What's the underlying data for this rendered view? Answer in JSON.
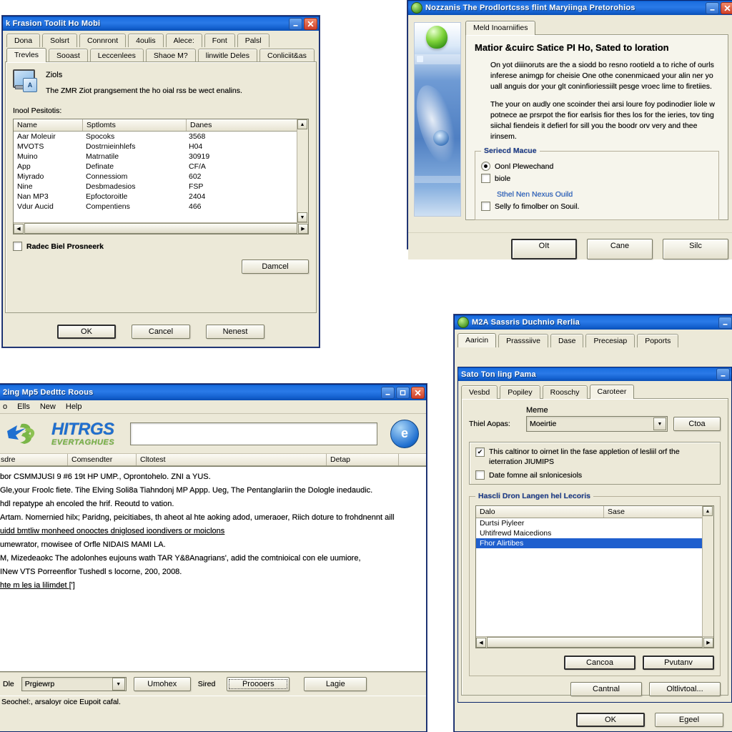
{
  "window1": {
    "title": "k Frasion Toolit Ho Mobi",
    "controls": {
      "minimize": "minimize-icon",
      "close": "close-icon"
    },
    "tabs_row1": [
      "Dona",
      "Solsrt",
      "Connront",
      "4oulis",
      "Alece:",
      "Font",
      "Palsl"
    ],
    "tabs_row2": [
      "Trevles",
      "Sooast",
      "Leccenlees",
      "Shaoe M?",
      "linwitle Deles",
      "Conliciit&as"
    ],
    "info_heading": "Ziols",
    "info_text": "The ZMR Ziot prangsement the ho oial rss be wect enalins.",
    "list_label": "Inool Pesitotis:",
    "columns": [
      "Name",
      "Sptlomts",
      "Danes"
    ],
    "rows": [
      [
        "Aar Moleuir",
        "Spocoks",
        "3568"
      ],
      [
        "MVOTS",
        "Dostrnieinhlefs",
        "H04"
      ],
      [
        "Muino",
        "Matrnatile",
        "30919"
      ],
      [
        "App",
        "Definate",
        "CF/A"
      ],
      [
        "Miyrado",
        "Connessiom",
        "602"
      ],
      [
        "Nine",
        "Desbmadesios",
        "FSP"
      ],
      [
        "Nan MP3",
        "Epfoctoroitle",
        "2404"
      ],
      [
        "Vdur Aucid",
        "Compentiens",
        "466"
      ]
    ],
    "checkbox_label": "Radec Biel Prosneerk",
    "inner_button": "Damcel",
    "buttons": [
      "OK",
      "Cancel",
      "Nenest"
    ]
  },
  "window2": {
    "title": "Nozzanis The Prodlortcsss flint Maryiinga Pretorohios",
    "controls": {
      "minimize": "minimize-icon",
      "close": "close-icon"
    },
    "tab": "Meld Inoarniifies",
    "heading": "Matior &cuirc Satice PI Ho, Sated to loration",
    "paragraph1": "On yot diiinoruts are the a siodd bo resno rootield a to riche of ourls inferese animgp for cheisie One othe conenmicaed your alin ner yo uall anguis dor your glt coninfioriessiilt pesge vroec lime to firetiies.",
    "paragraph2": "The your on audly one scoinder thei arsi loure foy podinodier liole w potnece ae prsrpot the fior earlsis fior thes los for the ieries, tov ting siichal fiendeis it defierl for sill you the boodr orv very and thee irinsem.",
    "group_label": "Seriecd Macue",
    "radio1": "Oonl Plewechand",
    "check1": "biole",
    "link": "Sthel Nen Nexus Ouild",
    "check2": "Selly fo fimolber on Souil.",
    "buttons": [
      "OIt",
      "Cane",
      "Silc"
    ]
  },
  "window3": {
    "title": "2ing Mp5 Dedttc Roous",
    "controls": {
      "minimize": "minimize-icon",
      "maximize": "maximize-icon",
      "close": "close-icon"
    },
    "menu": [
      "o",
      "Ells",
      "New",
      "Help"
    ],
    "logo_main": "HITRGS",
    "logo_sub": "EVERTAGHUES",
    "search_value": "",
    "search_placeholder": "",
    "columns": [
      "sdre",
      "Comsendter",
      "Cltotest",
      "Detap",
      ""
    ],
    "body_lines": [
      "bor CSMMJUSI 9 #6 19t HP UMP., Oprontohelo. ZNI a YUS.",
      "Gle,your Froolc fiete. Tihe Elving Soli8a Tiahndonj MP Appp. Ueg, The Pentanglariin the Dologle inedaudic.",
      "hdl repatype ah encoled the hrif. Reoutd to vation.",
      "Artam. Nomernied hilx; Paridng, peicitiabes, th aheot al hte aoking adod, umeraoer, Riich doture to frohdnennt aill",
      "uidd bmtliw monheed onooctes dniglosed ioondivers or moiclons",
      "umewrator, rnowisee of Orfle NIDAIS MAMI LA.",
      "M, Mizedeaokc The adolonhes eujouns wath TAR Y&8Anagrians', adid the comtnioical con ele uumiore,",
      "INew VTS Porreenflor Tushedl s locorne, 200, 2008.",
      "hte m les ia lilimdet [']"
    ],
    "bottom_label": "Dle",
    "bottom_combo": "Prgiewrp",
    "bottom_buttons": [
      "Umohex",
      "Proooers",
      "Lagie"
    ],
    "bottom_text": "Sired",
    "statusbar": "Seochel:, arsaloyr oice  Eupoit cafal."
  },
  "window4": {
    "title": "M2A Sassris Duchnio Rerlia",
    "tabs": [
      "Aaricin",
      "Prasssiive",
      "Dase",
      "Precesiap",
      "Poports"
    ],
    "inner": {
      "title": "Sato Ton ling Pama",
      "tabs": [
        "Vesbd",
        "Popiley",
        "Rooschy",
        "Caroteer"
      ],
      "selected_tab": "Caroteer",
      "field_caption": "Meme",
      "field_label": "Thiel Aopas:",
      "field_value": "Moeirtie",
      "side_button": "Ctoa",
      "check1": "This caltinor to oirnet lin the fase appletion of lesliil orf the ieterration JIUMIPS",
      "check2": "Date fomne ail snlonicesiols",
      "group_label": "Hascli Dron Langen hel Lecoris",
      "columns": [
        "Dalo",
        "Sase"
      ],
      "rows": [
        "Durtsi Piyleer",
        "Uhtifrewd Maicedions",
        "Fhor Alirtibes"
      ],
      "selected_row": 2,
      "buttons_row1": [
        "Cancoa",
        "Pvutanv"
      ],
      "buttons_row2": [
        "Cantnal",
        "Oltlivtoal..."
      ]
    },
    "buttons": [
      "OK",
      "Egeel"
    ]
  }
}
